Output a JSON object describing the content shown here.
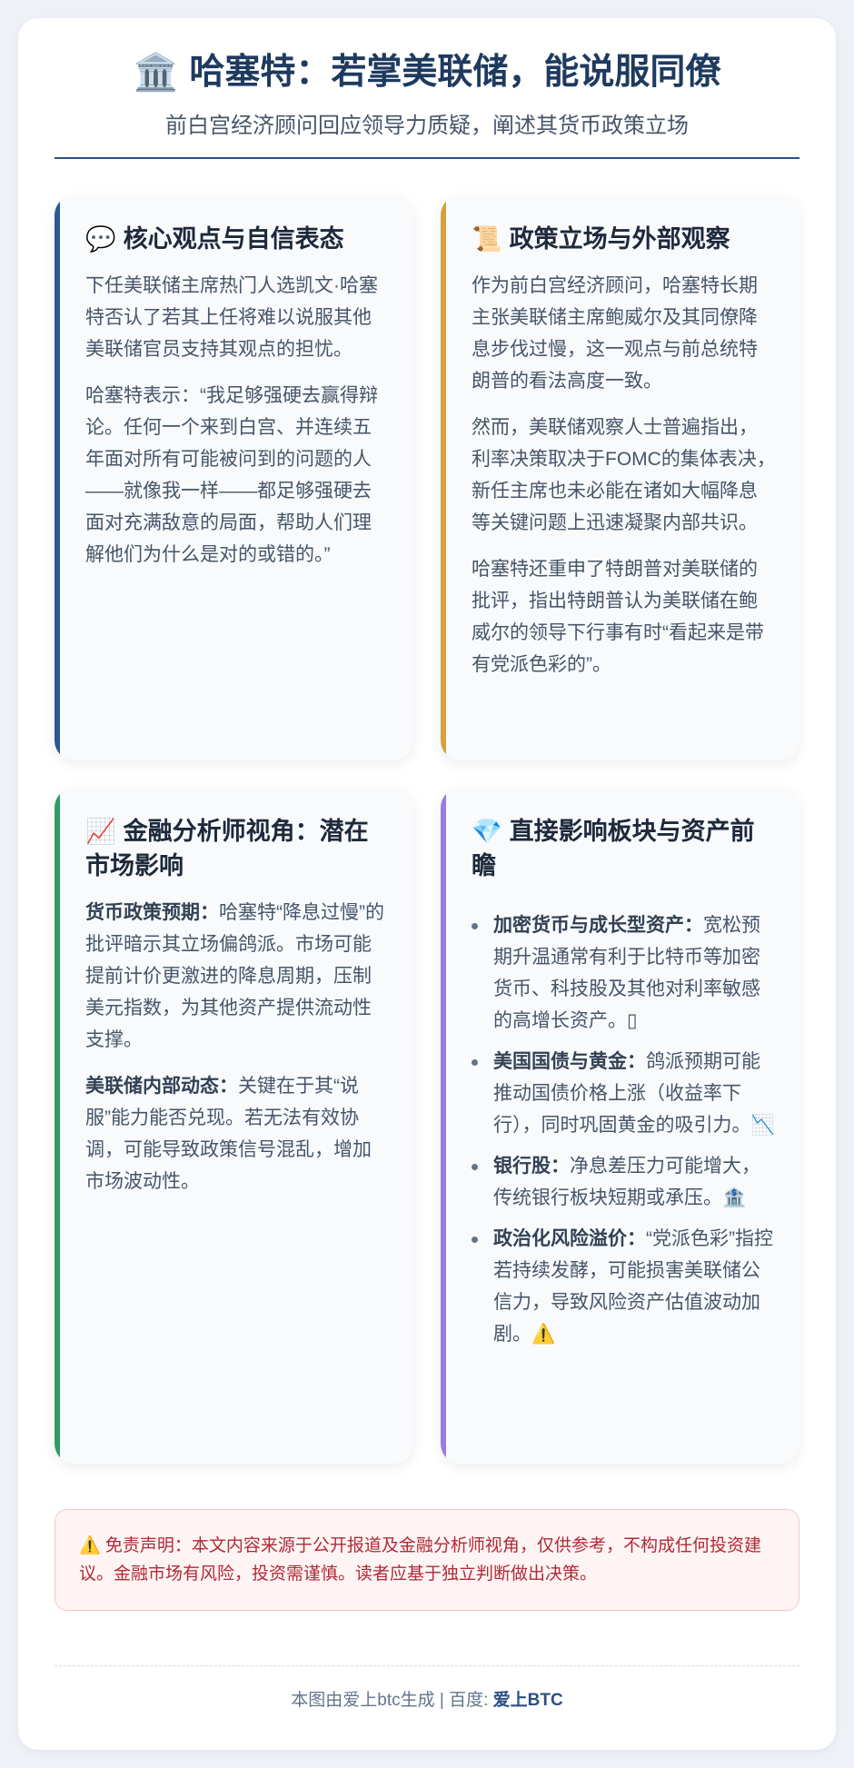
{
  "header": {
    "icon": "🏛️",
    "icon_name": "bank-building-icon",
    "title": "哈塞特：若掌美联储，能说服同僚",
    "subtitle": "前白宫经济顾问回应领导力质疑，阐述其货币政策立场"
  },
  "cards": [
    {
      "icon": "💬",
      "title": "核心观点与自信表态",
      "paragraphs": [
        "下任美联储主席热门人选凯文·哈塞特否认了若其上任将难以说服其他美联储官员支持其观点的担忧。",
        "哈塞特表示：“我足够强硬去赢得辩论。任何一个来到白宫、并连续五年面对所有可能被问到的问题的人——就像我一样——都足够强硬去面对充满敌意的局面，帮助人们理解他们为什么是对的或错的。”"
      ]
    },
    {
      "icon": "📜",
      "title": "政策立场与外部观察",
      "paragraphs": [
        "作为前白宫经济顾问，哈塞特长期主张美联储主席鲍威尔及其同僚降息步伐过慢，这一观点与前总统特朗普的看法高度一致。",
        "然而，美联储观察人士普遍指出，利率决策取决于FOMC的集体表决，新任主席也未必能在诸如大幅降息等关键问题上迅速凝聚内部共识。",
        "哈塞特还重申了特朗普对美联储的批评，指出特朗普认为美联储在鲍威尔的领导下行事有时“看起来是带有党派色彩的”。"
      ]
    },
    {
      "icon": "📈",
      "title": "金融分析师视角：潜在市场影响",
      "items": [
        {
          "label": "货币政策预期：",
          "text": "哈塞特“降息过慢”的批评暗示其立场偏鸽派。市场可能提前计价更激进的降息周期，压制美元指数，为其他资产提供流动性支撑。"
        },
        {
          "label": "美联储内部动态：",
          "text": "关键在于其“说服”能力能否兑现。若无法有效协调，可能导致政策信号混乱，增加市场波动性。"
        }
      ]
    },
    {
      "icon": "💎",
      "title": "直接影响板块与资产前瞻",
      "bullets": [
        {
          "label": "加密货币与成长型资产：",
          "text": "宽松预期升温通常有利于比特币等加密货币、科技股及其他对利率敏感的高增长资产。▯"
        },
        {
          "label": "美国国债与黄金：",
          "text": "鸽派预期可能推动国债价格上涨（收益率下行），同时巩固黄金的吸引力。📉"
        },
        {
          "label": "银行股：",
          "text": "净息差压力可能增大，传统银行板块短期或承压。🏦"
        },
        {
          "label": "政治化风险溢价：",
          "text": "“党派色彩”指控若持续发酵，可能损害美联储公信力，导致风险资产估值波动加剧。⚠️"
        }
      ]
    }
  ],
  "disclaimer": "⚠️ 免责声明：本文内容来源于公开报道及金融分析师视角，仅供参考，不构成任何投资建议。金融市场有风险，投资需谨慎。读者应基于独立判断做出决策。",
  "footer": {
    "prefix": "本图由爱上btc生成 | 百度: ",
    "brand": "爱上BTC"
  },
  "colors": {
    "title": "#1e3a5f",
    "accent_blue": "#2b5797",
    "accent_gold": "#d4a13a",
    "accent_green": "#2f9e64",
    "accent_purple": "#9b7be0",
    "disclaimer_text": "#b02a37"
  }
}
